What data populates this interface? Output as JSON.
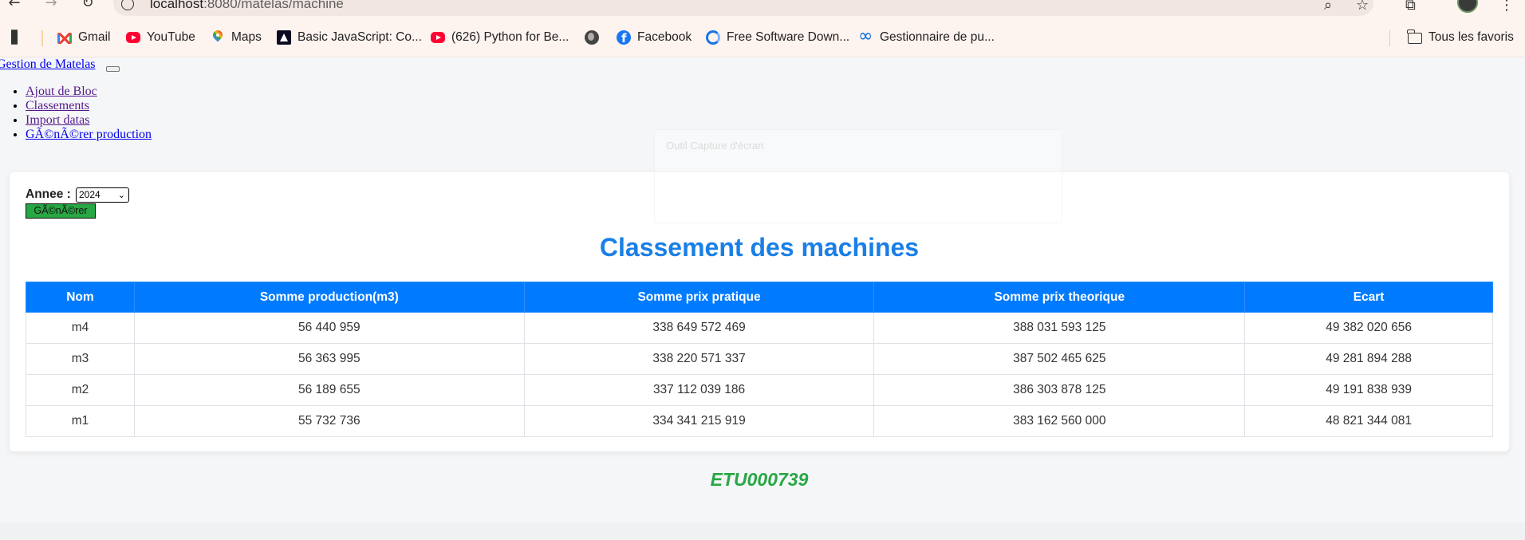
{
  "browser": {
    "url_host": "localhost",
    "url_rest": ":8080/matelas/machine",
    "bookmarks": [
      {
        "label": "Gmail",
        "icon": "gmail-icon"
      },
      {
        "label": "YouTube",
        "icon": "youtube-icon"
      },
      {
        "label": "Maps",
        "icon": "maps-icon"
      },
      {
        "label": "Basic JavaScript: Co...",
        "icon": "freecodecamp-icon"
      },
      {
        "label": "(626) Python for Be...",
        "icon": "youtube-icon"
      },
      {
        "label": "",
        "icon": "globe-icon"
      },
      {
        "label": "Facebook",
        "icon": "facebook-icon"
      },
      {
        "label": "Free Software Down...",
        "icon": "software-icon"
      },
      {
        "label": "Gestionnaire de pu...",
        "icon": "meta-icon"
      }
    ],
    "all_bookmarks": "Tous les favoris"
  },
  "nav": {
    "brand": "Gestion de Matelas",
    "items": [
      "Ajout de Bloc",
      "Classements",
      "Import datas",
      "GÃ©nÃ©rer production"
    ]
  },
  "overlay": {
    "label": "Outil Capture d'écran"
  },
  "form": {
    "year_label": "Annee :",
    "year_selected": "2024",
    "generate_label": "GÃ©nÃ©rer"
  },
  "main": {
    "title": "Classement des machines",
    "columns": [
      "Nom",
      "Somme production(m3)",
      "Somme prix pratique",
      "Somme prix theorique",
      "Ecart"
    ],
    "rows": [
      [
        "m4",
        "56 440 959",
        "338 649 572 469",
        "388 031 593 125",
        "49 382 020 656"
      ],
      [
        "m3",
        "56 363 995",
        "338 220 571 337",
        "387 502 465 625",
        "49 281 894 288"
      ],
      [
        "m2",
        "56 189 655",
        "337 112 039 186",
        "386 303 878 125",
        "49 191 838 939"
      ],
      [
        "m1",
        "55 732 736",
        "334 341 215 919",
        "383 162 560 000",
        "48 821 344 081"
      ]
    ],
    "footer_id": "ETU000739"
  },
  "colors": {
    "primary": "#007bff",
    "success": "#28a745",
    "title": "#1a7fe6"
  }
}
